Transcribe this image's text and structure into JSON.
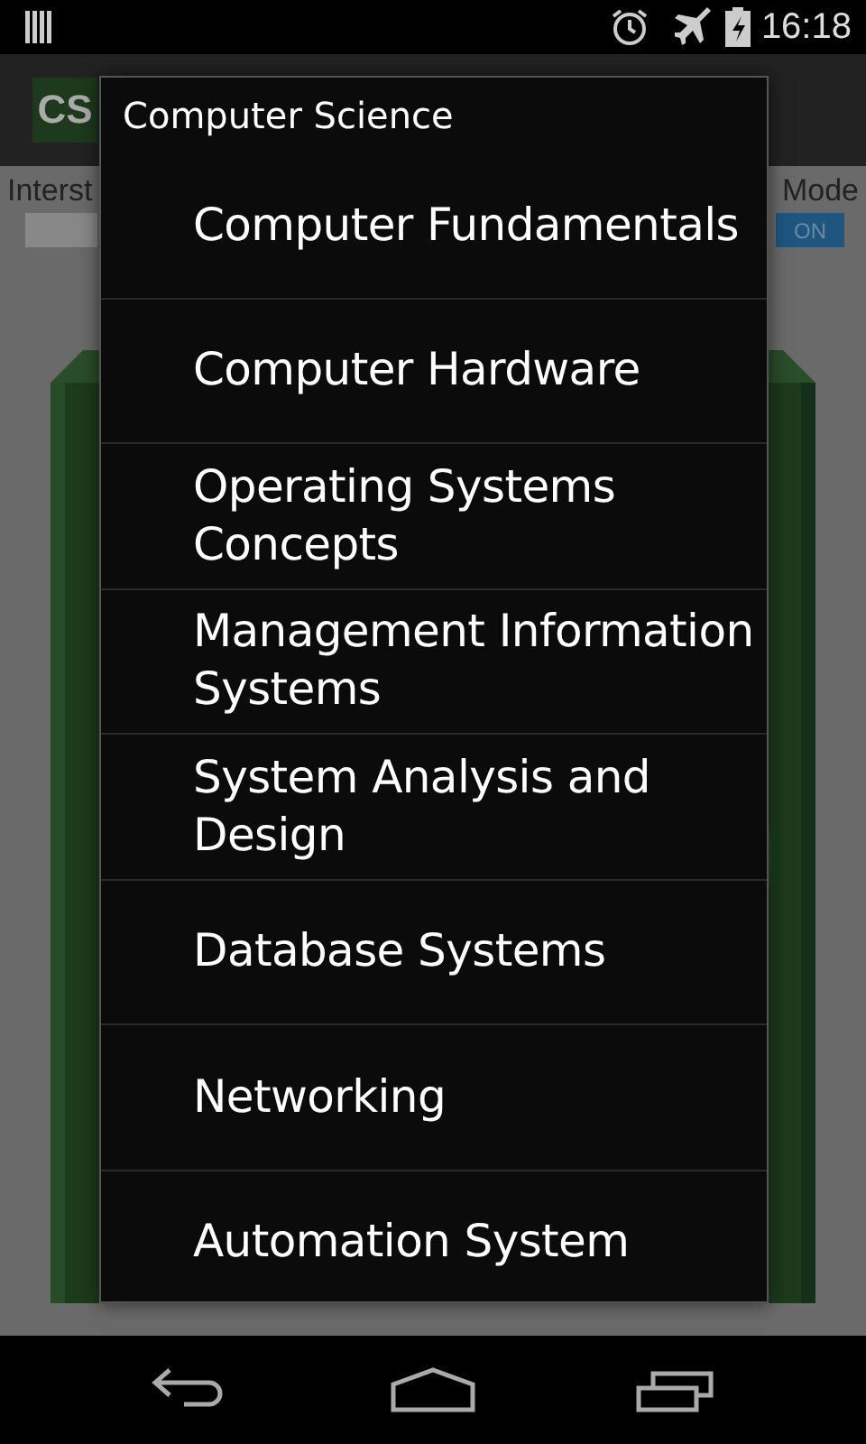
{
  "status_bar": {
    "time": "16:18"
  },
  "app_bar": {
    "logo": "CS"
  },
  "settings": [
    {
      "label": "Interst",
      "on": false
    },
    {
      "label": "Mode",
      "on": true,
      "toggle": "ON"
    }
  ],
  "dialog": {
    "title": "Computer Science",
    "items": [
      {
        "label": "Computer Fundamentals"
      },
      {
        "label": "Computer Hardware"
      },
      {
        "label": "Operating Systems Concepts"
      },
      {
        "label": "Management Information Systems"
      },
      {
        "label": "System Analysis and Design"
      },
      {
        "label": "Database Systems"
      },
      {
        "label": "Networking"
      },
      {
        "label": "Automation System"
      }
    ]
  }
}
